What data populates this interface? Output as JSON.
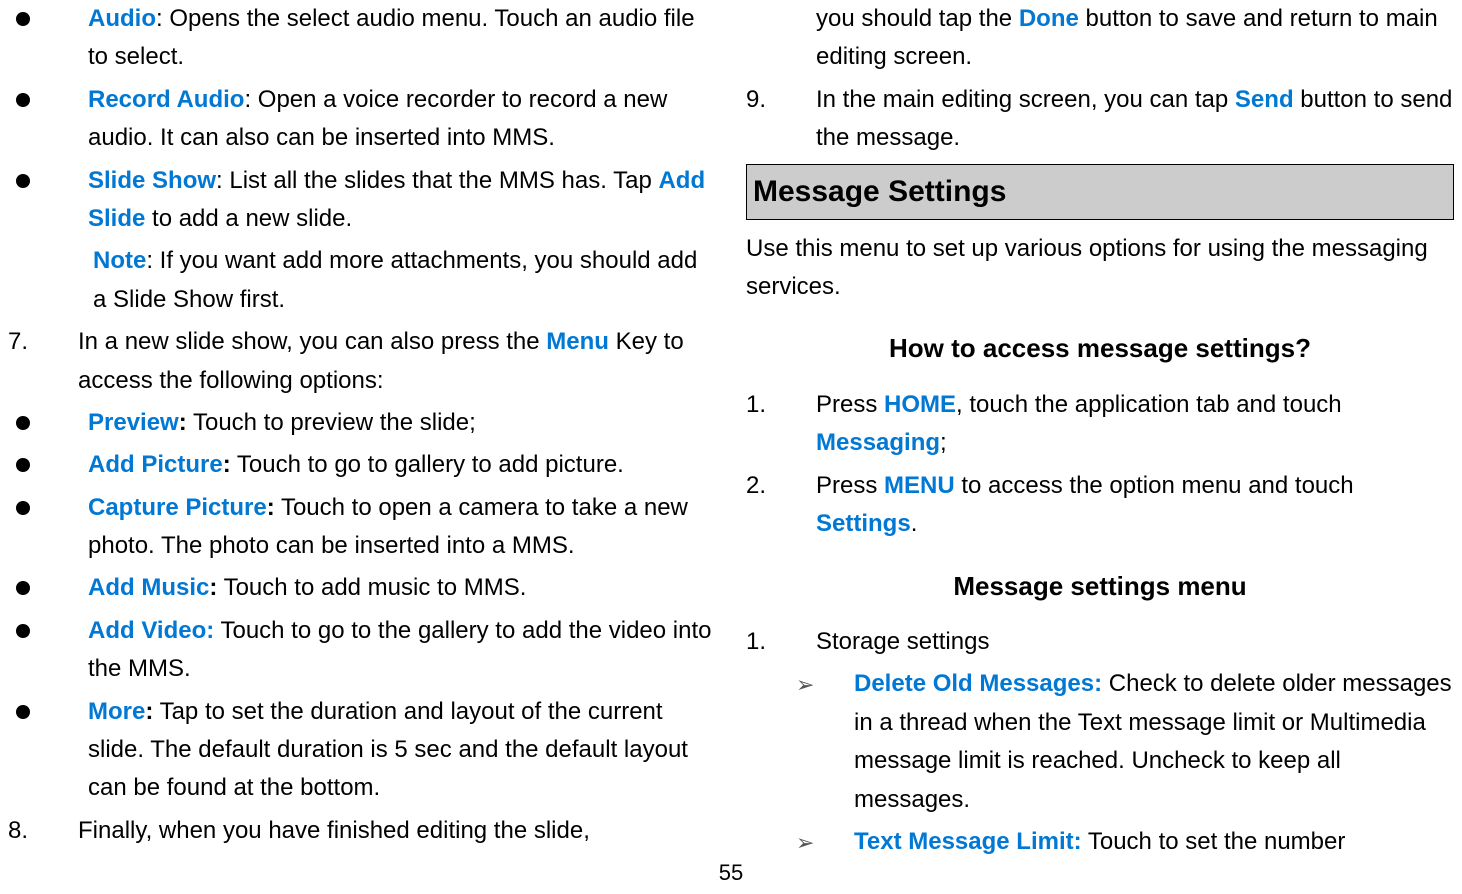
{
  "left": {
    "b1": {
      "label": "Audio",
      "text": ": Opens the select audio menu. Touch an audio file to select."
    },
    "b2": {
      "label": "Record Audio",
      "text": ": Open a voice recorder to record a new audio. It can also can be inserted into MMS."
    },
    "b3": {
      "label": "Slide Show",
      "text": ": List all the slides that the MMS has. Tap ",
      "inner": "Add Slide",
      "text2": " to add a new slide."
    },
    "note": {
      "label": "Note",
      "text": ": If you want add more attachments, you should add a Slide Show first."
    },
    "n7": {
      "num": "7.",
      "text": "In a new slide show, you can also press the ",
      "inner": "Menu",
      "text2": " Key to access the following options:"
    },
    "b4": {
      "label": "Preview",
      "text": " Touch to preview the slide;"
    },
    "b5": {
      "label": "Add Picture",
      "text": " Touch to go to gallery to add picture."
    },
    "b6": {
      "label": "Capture Picture",
      "text": " Touch to open a camera to take a new photo. The photo can be inserted into a MMS."
    },
    "b7": {
      "label": "Add Music",
      "text": " Touch to add music to MMS."
    },
    "b8": {
      "label": "Add Video:",
      "text": " Touch to go to the gallery to add the video into the MMS."
    },
    "b9": {
      "label": "More",
      "text": " Tap to set the duration and layout of the current slide. The default duration is 5 sec and the default layout can be found at the bottom."
    },
    "n8": {
      "num": "8.",
      "text": "Finally, when you have finished editing the slide,"
    }
  },
  "right": {
    "cont8": {
      "text1": "you should tap the ",
      "inner": "Done",
      "text2": " button to save and return to main editing screen."
    },
    "n9": {
      "num": "9.",
      "text1": "In the main editing screen, you can tap ",
      "inner": "Send",
      "text2": " button to send the message."
    },
    "header": "Message Settings",
    "intro": "Use this menu to set up various options for using the messaging services.",
    "subheader1": "How to access message settings?",
    "s1n1": {
      "num": "1.",
      "text1": "Press ",
      "inner1": "HOME",
      "text2": ", touch the application tab and touch ",
      "inner2": "Messaging",
      "text3": ";"
    },
    "s1n2": {
      "num": "2.",
      "text1": "Press ",
      "inner1": "MENU",
      "text2": " to access the option menu and touch ",
      "inner2": "Settings",
      "text3": "."
    },
    "subheader2": "Message settings menu",
    "s2n1": {
      "num": "1.",
      "text": "Storage settings"
    },
    "a1": {
      "label": "Delete Old Messages:",
      "text": " Check to delete older messages in a thread when the Text message limit or Multimedia message limit is reached. Uncheck to keep all messages."
    },
    "a2": {
      "label": "Text Message Limit:",
      "text": " Touch to set the number"
    }
  },
  "pageNum": "55"
}
